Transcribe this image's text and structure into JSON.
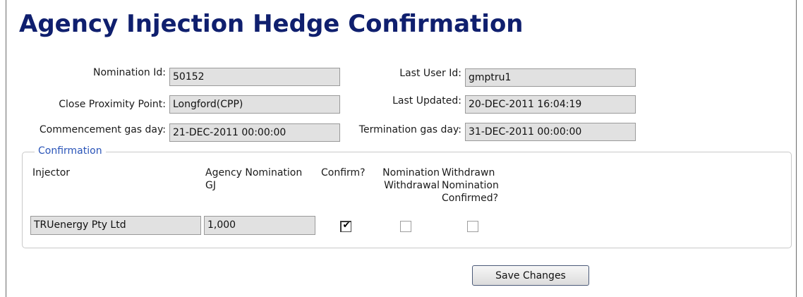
{
  "page": {
    "title": "Agency Injection Hedge Confirmation"
  },
  "fields": {
    "nomination_id": {
      "label": "Nomination Id:",
      "value": "50152"
    },
    "close_proximity_point": {
      "label": "Close Proximity Point:",
      "value": "Longford(CPP)"
    },
    "commencement_gas_day": {
      "label": "Commencement gas day:",
      "value": "21-DEC-2011 00:00:00"
    },
    "last_user_id": {
      "label": "Last User Id:",
      "value": "gmptru1"
    },
    "last_updated": {
      "label": "Last Updated:",
      "value": "20-DEC-2011 16:04:19"
    },
    "termination_gas_day": {
      "label": "Termination gas day:",
      "value": "31-DEC-2011 00:00:00"
    }
  },
  "confirmation": {
    "legend": "Confirmation",
    "columns": {
      "injector": "Injector",
      "agency_nomination_1": "Agency Nomination",
      "agency_nomination_2": "GJ",
      "confirm": "Confirm?",
      "nomination_withdrawal_1": "Nomination",
      "nomination_withdrawal_2": "Withdrawal",
      "withdrawn_confirmed_1": "Withdrawn",
      "withdrawn_confirmed_2": "Nomination",
      "withdrawn_confirmed_3": "Confirmed?"
    },
    "row": {
      "injector": "TRUenergy Pty Ltd",
      "agency_nomination_gj": "1,000",
      "confirm": true,
      "nomination_withdrawal": false,
      "withdrawn_nomination_confirmed": false,
      "check_glyph": "✔"
    }
  },
  "actions": {
    "save_label": "Save Changes"
  }
}
